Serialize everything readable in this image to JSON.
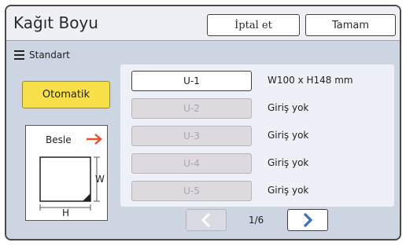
{
  "header": {
    "title": "Kağıt Boyu",
    "cancel_label": "İptal et",
    "ok_label": "Tamam"
  },
  "mode": {
    "icon": "list-icon",
    "label": "Standart"
  },
  "auto_button": {
    "label": "Otomatik",
    "color": "#f8e04a"
  },
  "diagram": {
    "feed_label": "Besle",
    "width_label": "W",
    "height_label": "H",
    "arrow_color": "#e8502e"
  },
  "slots": [
    {
      "label": "U-1",
      "description": "W100 x H148 mm",
      "state": "active"
    },
    {
      "label": "U-2",
      "description": "Giriş yok",
      "state": "disabled"
    },
    {
      "label": "U-3",
      "description": "Giriş yok",
      "state": "disabled"
    },
    {
      "label": "U-4",
      "description": "Giriş yok",
      "state": "disabled"
    },
    {
      "label": "U-5",
      "description": "Giriş yok",
      "state": "disabled"
    }
  ],
  "pager": {
    "page_label": "1/6",
    "prev_icon": "chevron-left-icon",
    "next_icon": "chevron-right-icon",
    "accent": "#3a6fb0"
  }
}
